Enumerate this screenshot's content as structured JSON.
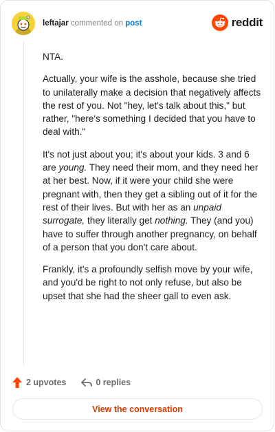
{
  "header": {
    "username": "leftajar",
    "action": "commented on",
    "link": "post",
    "brand": "reddit"
  },
  "comment": {
    "paragraphs": [
      [
        {
          "text": "NTA."
        }
      ],
      [
        {
          "text": "Actually, your wife is the asshole, because she tried to unilaterally make a decision that negatively affects the rest of you. Not \"hey, let's talk about this,\" but rather, \"here's something I decided that you have to deal with.\""
        }
      ],
      [
        {
          "text": "It's not just about you; it's about your kids. 3 and 6 are "
        },
        {
          "text": "young.",
          "italic": true
        },
        {
          "text": " They need their mom, and they need her at her best. Now, if it were your child she were pregnant with, then they get a sibling out of it for the rest of their lives. But with her as an "
        },
        {
          "text": "unpaid surrogate,",
          "italic": true
        },
        {
          "text": " they literally get "
        },
        {
          "text": "nothing.",
          "italic": true
        },
        {
          "text": " They (and you) have to suffer through another pregnancy, on behalf of a person that you don't care about."
        }
      ],
      [
        {
          "text": "Frankly, it's a profoundly selfish move by your wife, and you'd be right to not only refuse, but also be upset that she had the sheer gall to even ask."
        }
      ]
    ]
  },
  "footer": {
    "upvotes": "2 upvotes",
    "replies": "0 replies",
    "cta": "View the conversation"
  },
  "icons": {
    "avatar": "snoo-avatar-icon",
    "logo": "reddit-logo-icon",
    "upvote": "upvote-arrow-icon",
    "reply": "reply-arrow-icon"
  },
  "colors": {
    "brand": "#ff4500",
    "link": "#0079d3",
    "upvote": "#ff4500",
    "cta": "#d93a00",
    "avatar_bg": "#f2d43a"
  }
}
